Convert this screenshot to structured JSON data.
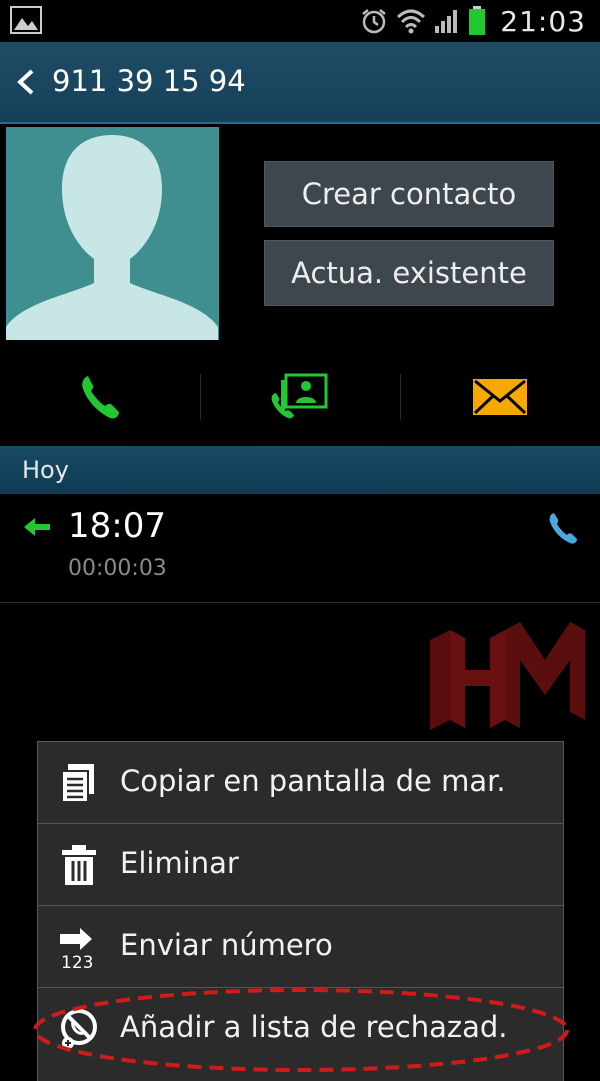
{
  "status_bar": {
    "time": "21:03",
    "icons": [
      "gallery-icon",
      "alarm-icon",
      "wifi-icon",
      "signal-icon",
      "battery-icon"
    ],
    "battery_color": "#22c832"
  },
  "action_bar": {
    "title": "911 39 15 94"
  },
  "contact": {
    "create_label": "Crear contacto",
    "update_label": "Actua. existente",
    "photo_color": "#3f8f91"
  },
  "quick_actions": [
    "call-icon",
    "video-call-icon",
    "message-icon"
  ],
  "section": {
    "label": "Hoy"
  },
  "call_log": [
    {
      "direction": "incoming",
      "time": "18:07",
      "duration": "00:00:03",
      "type_icon": "phone-icon"
    }
  ],
  "menu": {
    "items": [
      {
        "label": "Copiar en pantalla de mar.",
        "icon": "copy-icon"
      },
      {
        "label": "Eliminar",
        "icon": "trash-icon"
      },
      {
        "label": "Enviar número",
        "icon": "send-number-icon"
      },
      {
        "label": "Añadir a lista de rechazad.",
        "icon": "block-icon"
      }
    ]
  },
  "colors": {
    "accent_green": "#22c832",
    "header_blue": "#1a4a64",
    "highlight_red": "#d11a1a"
  }
}
